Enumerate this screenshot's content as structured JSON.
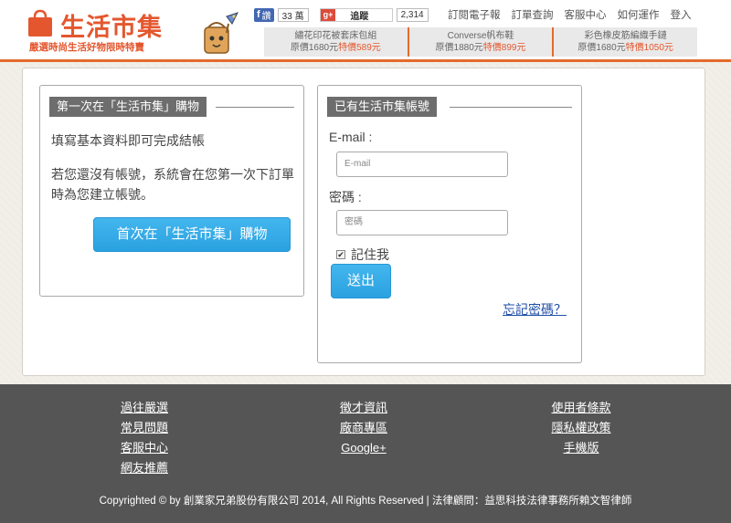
{
  "brand": {
    "name": "生活市集",
    "tagline": "嚴選時尚生活好物限時特賣"
  },
  "social": {
    "fb_label": "讚",
    "fb_count": "33 萬",
    "gplus_label": "追蹤",
    "gplus_count": "2,314"
  },
  "topnav": [
    "訂閱電子報",
    "訂單查詢",
    "客服中心",
    "如何運作",
    "登入"
  ],
  "promos": [
    {
      "name": "繡花印花被套床包組",
      "orig": "原價1680元",
      "sale": "特價589元"
    },
    {
      "name": "Converse帆布鞋",
      "orig": "原價1880元",
      "sale": "特價899元"
    },
    {
      "name": "彩色橡皮筋編織手鏈",
      "orig": "原價1680元",
      "sale": "特價1050元"
    }
  ],
  "first_time": {
    "heading": "第一次在「生活市集」購物",
    "intro": "填寫基本資料即可完成結帳",
    "desc": "若您還沒有帳號，系統會在您第一次下訂單時為您建立帳號。",
    "button": "首次在「生活市集」購物"
  },
  "login": {
    "heading": "已有生活市集帳號",
    "email_label": "E-mail :",
    "email_placeholder": "E-mail",
    "password_label": "密碼 :",
    "password_placeholder": "密碼",
    "remember_label": "記住我",
    "remember_checked": true,
    "submit": "送出",
    "forgot": "忘記密碼？"
  },
  "footer": {
    "col1": [
      "過往嚴選",
      "常見問題",
      "客服中心",
      "網友推薦"
    ],
    "col2": [
      "徵才資訊",
      "廠商專區",
      "Google+"
    ],
    "col3": [
      "使用者條款",
      "隱私權政策",
      "手機版"
    ],
    "copyright": "Copyrighted © by 創業家兄弟股份有限公司 2014, All Rights Reserved | 法律顧問：益思科技法律事務所賴文智律師"
  },
  "colors": {
    "brand_orange": "#e4572e",
    "button_blue": "#2aa1e0",
    "footer_bg": "#555555"
  }
}
